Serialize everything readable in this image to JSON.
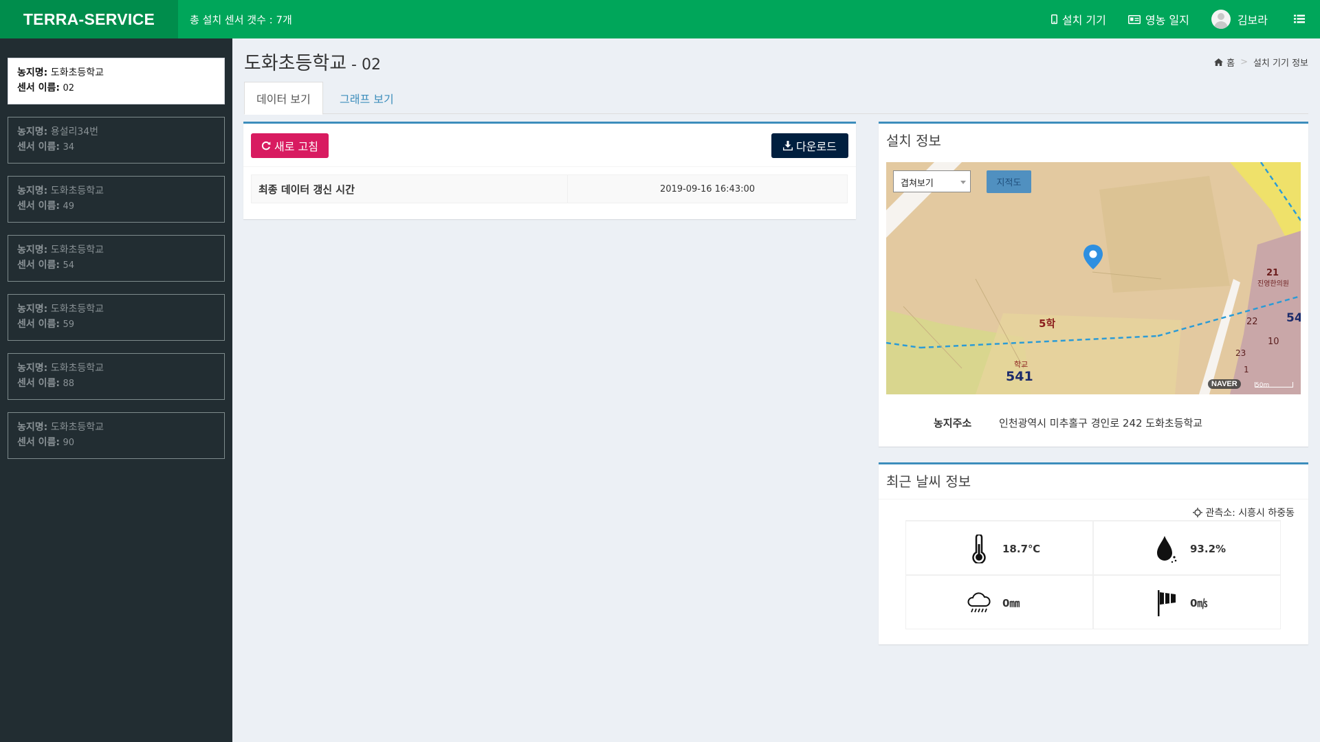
{
  "header": {
    "logo": "TERRA-SERVICE",
    "sensor_count": "총 설치 센서 갯수 : 7개",
    "nav_devices": "설치 기기",
    "nav_journal": "영농 일지",
    "user_name": "김보라"
  },
  "sidebar": {
    "farm_label": "농지명:",
    "sensor_label": "센서 이름:",
    "items": [
      {
        "farm": "도화초등학교",
        "sensor": "02"
      },
      {
        "farm": "용설리34번",
        "sensor": "34"
      },
      {
        "farm": "도화초등학교",
        "sensor": "49"
      },
      {
        "farm": "도화초등학교",
        "sensor": "54"
      },
      {
        "farm": "도화초등학교",
        "sensor": "59"
      },
      {
        "farm": "도화초등학교",
        "sensor": "88"
      },
      {
        "farm": "도화초등학교",
        "sensor": "90"
      }
    ]
  },
  "page": {
    "title": "도화초등학교",
    "title_suffix": " - 02",
    "breadcrumb_home": "홈",
    "breadcrumb_current": "설치 기기 정보"
  },
  "tabs": {
    "data_view": "데이터 보기",
    "graph_view": "그래프 보기"
  },
  "data_box": {
    "refresh_label": "새로 고침",
    "download_label": "다운로드",
    "last_update_label": "최종 데이터 갱신 시간",
    "last_update_value": "2019-09-16 16:43:00"
  },
  "install_info": {
    "title": "설치 정보",
    "map_select_value": "겹쳐보기",
    "map_button": "지적도",
    "address_label": "농지주소",
    "address_value": "인천광역시 미추홀구 경인로 242 도화초등학교",
    "map_labels": {
      "main_parcel": "5학",
      "school": "학교",
      "parcel_541": "541",
      "n21": "21",
      "n22": "22",
      "n10": "10",
      "n23": "23",
      "n1": "1",
      "n54": "54",
      "building": "진영한의원"
    },
    "naver": "NAVER",
    "scale": "50m"
  },
  "weather": {
    "title": "최근 날씨 정보",
    "station": "관측소: 시흥시 하중동",
    "temperature": "18.7℃",
    "humidity": "93.2%",
    "rain": "0㎜",
    "wind": "0㎧"
  },
  "colors": {
    "header": "#00a65a",
    "logo_bg": "#008d4c",
    "sidebar": "#222d32",
    "refresh": "#d81b60",
    "download": "#001f3f",
    "box_border": "#3c8dbc"
  }
}
